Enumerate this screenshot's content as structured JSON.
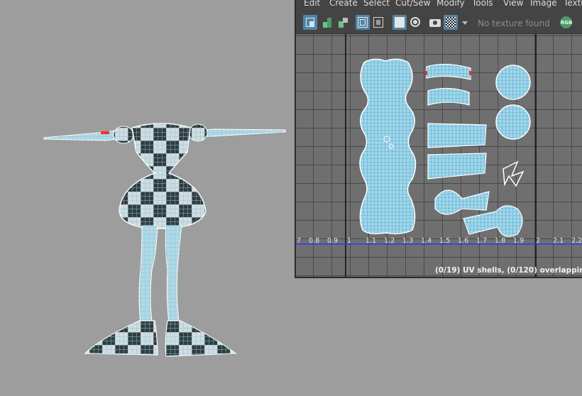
{
  "uv_editor": {
    "menu": [
      "Edit",
      "Create",
      "Select",
      "Cut/Sew",
      "Modify",
      "Tools",
      "View",
      "Image",
      "Textu"
    ],
    "texture_dropdown": "No texture found",
    "status": "(0/19) UV shells, (0/120) overlapping UVs,",
    "tick_labels": [
      "7",
      "0.8",
      "0.9",
      "1",
      "1.1",
      "1.2",
      "1.3",
      "1.4",
      "1.5",
      "1.6",
      "1.7",
      "1.8",
      "1.9",
      "2",
      "2.1",
      "2.2"
    ],
    "toolbar_icons": [
      "uv-shell-select-icon",
      "uv-layout-icon",
      "uv-checker-shade-icon",
      "isolate-select-icon",
      "uv-border-icon",
      "grid-toggle-icon",
      "snap-pixel-icon",
      "camera-icon",
      "checker-pattern-icon",
      "dropdown-arrow-icon"
    ],
    "rgb_label": "RGB"
  },
  "colors": {
    "wire": "#5fd3f5",
    "wire_edge": "#ffffff",
    "uv_fill": "#9ed7ea",
    "checker_dark": "#3a3a3a",
    "checker_light": "#d9d9d9",
    "axis_line": "#2a3cff",
    "accent_red": "#ff2a2a",
    "toolbar_active": "#5285a6",
    "viewport_bg": "#9d9d9d"
  }
}
